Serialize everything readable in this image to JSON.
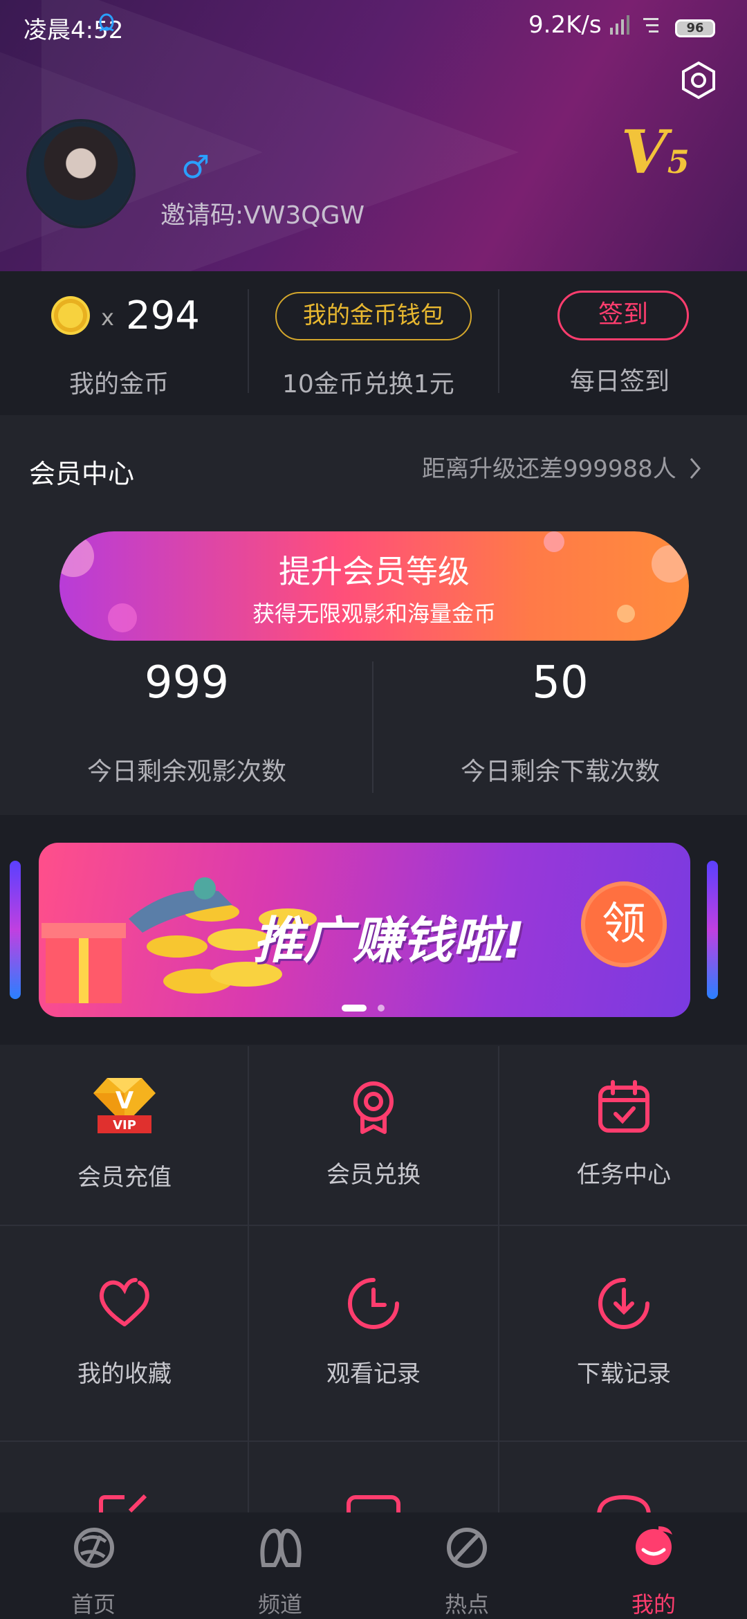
{
  "status_bar": {
    "time": "凌晨4:52",
    "speed": "9.2K/s",
    "battery": "96"
  },
  "profile": {
    "gender_symbol": "♂",
    "invite": "邀请码:VW3QGW",
    "vip_level": "V",
    "vip_level_num": "5"
  },
  "coins": {
    "x": "x",
    "count": "294",
    "my_coins_label": "我的金币",
    "wallet_label": "我的金币钱包",
    "exchange_text": "10金币兑换1元",
    "signin_label": "签到",
    "daily_signin_label": "每日签到"
  },
  "member": {
    "title": "会员中心",
    "upgrade_hint": "距离升级还差999988人",
    "upgrade_title": "提升会员等级",
    "upgrade_sub": "获得无限观影和海量金币",
    "watch_count": "999",
    "watch_label": "今日剩余观影次数",
    "download_count": "50",
    "download_label": "今日剩余下载次数"
  },
  "banner": {
    "text": "推广赚钱啦!",
    "badge": "领",
    "vip_tag": "VIP"
  },
  "grid": [
    {
      "label": "会员充值",
      "icon": "vip-crown-icon"
    },
    {
      "label": "会员兑换",
      "icon": "medal-icon"
    },
    {
      "label": "任务中心",
      "icon": "calendar-check-icon"
    },
    {
      "label": "我的收藏",
      "icon": "heart-icon"
    },
    {
      "label": "观看记录",
      "icon": "clock-icon"
    },
    {
      "label": "下载记录",
      "icon": "download-icon"
    }
  ],
  "nav": [
    {
      "label": "首页",
      "icon": "home-icon"
    },
    {
      "label": "频道",
      "icon": "channel-icon"
    },
    {
      "label": "热点",
      "icon": "hot-icon"
    },
    {
      "label": "我的",
      "icon": "mine-icon"
    }
  ],
  "colors": {
    "accent": "#ff3d6e",
    "gold": "#f2c33a",
    "bg": "#23252c",
    "panel": "#1c1e25"
  }
}
